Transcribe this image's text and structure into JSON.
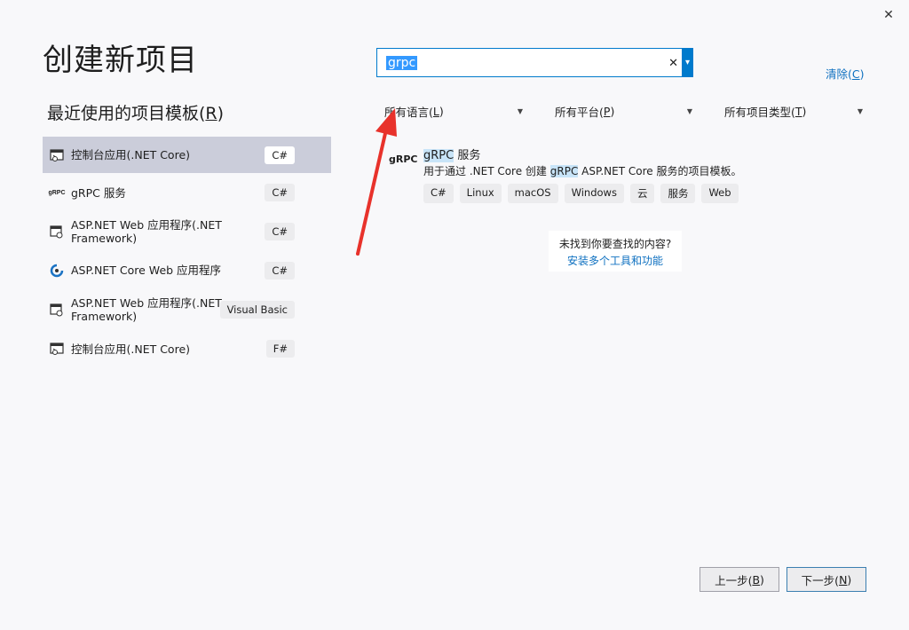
{
  "window": {
    "close_glyph": "✕"
  },
  "page_title": "创建新项目",
  "recent": {
    "title_pre": "最近使用的项目模板(",
    "title_key": "R",
    "title_post": ")",
    "items": [
      {
        "name": "控制台应用(.NET Core)",
        "badge": "C#",
        "icon": "console-icon",
        "selected": true
      },
      {
        "name": "gRPC 服务",
        "badge": "C#",
        "icon": "grpc-icon"
      },
      {
        "name": "ASP.NET Web 应用程序(.NET Framework)",
        "badge": "C#",
        "icon": "web-app-icon"
      },
      {
        "name": "ASP.NET Core Web 应用程序",
        "badge": "C#",
        "icon": "aspnet-core-icon"
      },
      {
        "name": "ASP.NET Web 应用程序(.NET Framework)",
        "badge": "Visual Basic",
        "icon": "web-app-icon"
      },
      {
        "name": "控制台应用(.NET Core)",
        "badge": "F#",
        "icon": "console-icon"
      }
    ]
  },
  "search": {
    "value": "grpc",
    "clear_glyph": "✕",
    "dropdown_glyph": "▾"
  },
  "clear_link": {
    "pre": "清除(",
    "key": "C",
    "post": ")"
  },
  "filters": {
    "language": {
      "pre": "所有语言(",
      "key": "L",
      "post": ")"
    },
    "platform": {
      "pre": "所有平台(",
      "key": "P",
      "post": ")"
    },
    "project_type": {
      "pre": "所有项目类型(",
      "key": "T",
      "post": ")"
    },
    "caret": "▼"
  },
  "result": {
    "icon_text": "gRPC",
    "title_hl": "gRPC",
    "title_rest": " 服务",
    "desc_pre": "用于通过 .NET Core 创建 ",
    "desc_hl": "gRPC",
    "desc_post": " ASP.NET Core 服务的项目模板。",
    "tags": [
      "C#",
      "Linux",
      "macOS",
      "Windows",
      "云",
      "服务",
      "Web"
    ]
  },
  "not_found": {
    "text": "未找到你要查找的内容?",
    "link": "安装多个工具和功能"
  },
  "buttons": {
    "back": {
      "pre": "上一步(",
      "key": "B",
      "post": ")"
    },
    "next": {
      "pre": "下一步(",
      "key": "N",
      "post": ")"
    }
  },
  "colors": {
    "accent": "#007acc",
    "link": "#0e70c0",
    "selected": "#cbcdda",
    "annotation": "#e8322b"
  }
}
